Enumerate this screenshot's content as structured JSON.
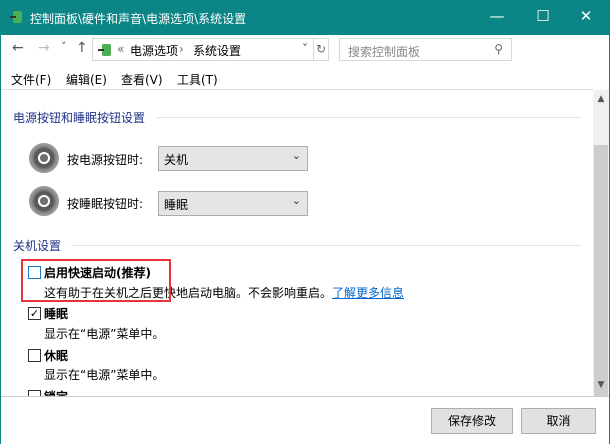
{
  "window": {
    "title": "控制面板\\硬件和声音\\电源选项\\系统设置",
    "min": "—",
    "max": "☐",
    "close": "✕"
  },
  "nav": {
    "back": "←",
    "forward": "→",
    "recent": "˅",
    "up": "↑",
    "overflow": "«",
    "crumbs": [
      "电源选项",
      "系统设置"
    ],
    "sep": "›",
    "dropdown": "˅",
    "refresh": "↻",
    "search_placeholder": "搜索控制面板"
  },
  "menu": [
    "文件(F)",
    "编辑(E)",
    "查看(V)",
    "工具(T)"
  ],
  "power_section": {
    "heading": "电源按钮和睡眠按钮设置",
    "rows": [
      {
        "label": "按电源按钮时:",
        "value": "关机"
      },
      {
        "label": "按睡眠按钮时:",
        "value": "睡眠"
      }
    ]
  },
  "shutdown_section": {
    "heading": "关机设置",
    "items": [
      {
        "label": "启用快速启动(推荐)",
        "checked": false,
        "desc": "这有助于在关机之后更快地启动电脑。不会影响重启。",
        "link": "了解更多信息"
      },
      {
        "label": "睡眠",
        "checked": true,
        "desc": "显示在“电源”菜单中。"
      },
      {
        "label": "休眠",
        "checked": false,
        "desc": "显示在“电源”菜单中。"
      },
      {
        "label": "锁定",
        "checked": false
      }
    ]
  },
  "footer": {
    "save": "保存修改",
    "cancel": "取消"
  },
  "colors": {
    "titlebar": "#0b8585",
    "highlight": "#e8343a",
    "link": "#0066cc"
  }
}
